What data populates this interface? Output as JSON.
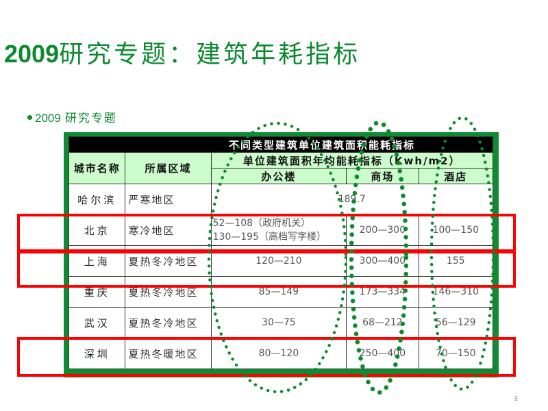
{
  "slide": {
    "title_number": "2009",
    "title_text": "研究专题：建筑年耗指标",
    "bullet_number": "2009",
    "bullet_text": "研究专题",
    "page_number": "3"
  },
  "table": {
    "title": "不同类型建筑单位建筑面积能耗指标",
    "col_city": "城市名称",
    "col_zone": "所属区域",
    "group_header": "单位建筑面积年均能耗指标（Kwh/m2）",
    "col_office": "办公楼",
    "col_mall": "商场",
    "col_hotel": "酒店",
    "rows": [
      {
        "city": "哈尔滨",
        "zone": "严寒地区",
        "merged": "189.7"
      },
      {
        "city": "北京",
        "zone": "寒冷地区",
        "office_line1": "52—108（政府机关）",
        "office_line2": "130—195（高档写字楼）",
        "mall": "200—300",
        "hotel": "100—150"
      },
      {
        "city": "上海",
        "zone": "夏热冬冷地区",
        "office": "120—210",
        "mall": "300—400",
        "hotel": "155"
      },
      {
        "city": "重庆",
        "zone": "夏热冬冷地区",
        "office": "85—149",
        "mall": "173—334",
        "hotel": "146—310"
      },
      {
        "city": "武汉",
        "zone": "夏热冬冷地区",
        "office": "30—75",
        "mall": "68—212",
        "hotel": "56—129"
      },
      {
        "city": "深圳",
        "zone": "夏热冬暖地区",
        "office": "80—120",
        "mall": "250—400",
        "hotel": "70—150"
      }
    ]
  },
  "annotations": {
    "highlight_color": "#ff0000",
    "oval_color": "#0b8a2e",
    "highlighted_cities": [
      "北京",
      "上海",
      "深圳"
    ],
    "circled_columns": [
      "办公楼",
      "商场",
      "酒店"
    ]
  }
}
